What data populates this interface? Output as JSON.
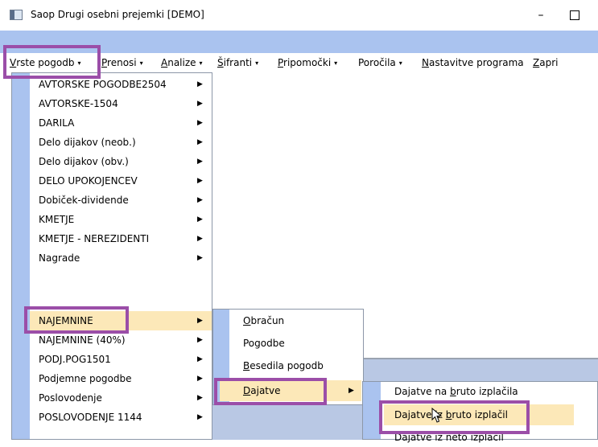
{
  "window": {
    "title": "Saop Drugi osebni prejemki [DEMO]",
    "minimize_glyph": "–"
  },
  "menubar": {
    "items": [
      {
        "accel": "V",
        "rest": "rste pogodb",
        "caret": "▾"
      },
      {
        "accel": "P",
        "rest": "renosi",
        "caret": "▾"
      },
      {
        "accel": "A",
        "rest": "nalize",
        "caret": "▾"
      },
      {
        "accel": "Š",
        "rest": "ifranti",
        "caret": "▾",
        "display_override": true
      },
      {
        "accel": "P",
        "rest": "ripomočki",
        "caret": "▾"
      },
      {
        "accel": "",
        "rest": "Poročila",
        "caret": "▾"
      },
      {
        "accel": "N",
        "rest": "astavitve programa",
        "caret": ""
      },
      {
        "accel": "Z",
        "rest": "apri",
        "caret": ""
      }
    ]
  },
  "menu1": {
    "items": [
      "AVTORSKE POGODBE2504",
      "AVTORSKE-1504",
      "DARILA",
      "Delo dijakov (neob.)",
      "Delo dijakov (obv.)",
      "DELO UPOKOJENCEV",
      "Dobiček-dividende",
      "KMETJE",
      "KMETJE - NEREZIDENTI",
      "Nagrade",
      "NAJEMNINE",
      "NAJEMNINE (40%)",
      "PODJ.POG1501",
      "Podjemne pogodbe",
      "Poslovodenje",
      "POSLOVODENJE 1144"
    ],
    "arrow": "▶"
  },
  "menu2": {
    "items": [
      {
        "accel": "O",
        "rest": "bračun"
      },
      {
        "accel": "",
        "rest": "Pogodbe",
        "under_index": 2
      },
      {
        "accel": "B",
        "rest": "esedila pogodb"
      },
      {
        "accel": "D",
        "rest": "ajatve"
      }
    ],
    "arrow": "▶"
  },
  "menu3": {
    "items": [
      {
        "pre": "Dajatve na ",
        "accel": "b",
        "post": "ruto izplačila"
      },
      {
        "pre": "Dajatve iz ",
        "accel": "b",
        "post": "ruto izplačil"
      },
      {
        "pre": "Dajatve iz neto izplačil",
        "accel": "",
        "post": ""
      }
    ]
  }
}
